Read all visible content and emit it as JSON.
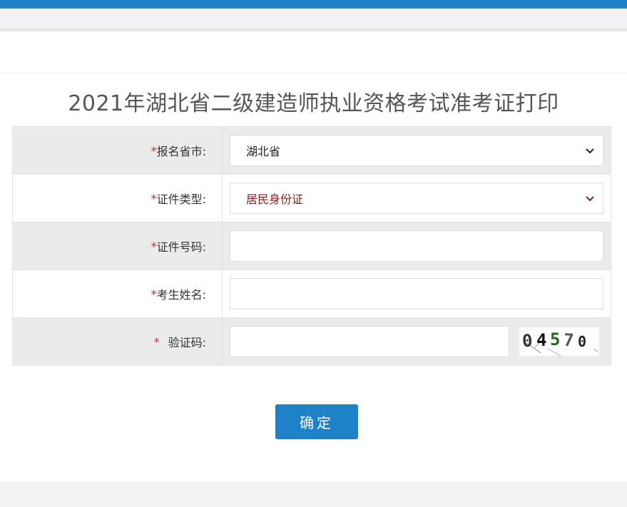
{
  "page": {
    "title": "2021年湖北省二级建造师执业资格考试准考证打印"
  },
  "form": {
    "province": {
      "required_mark": "*",
      "label": "报名省市:",
      "value": "湖北省"
    },
    "id_type": {
      "required_mark": "*",
      "label": "证件类型:",
      "value": "居民身份证"
    },
    "id_number": {
      "required_mark": "*",
      "label": "证件号码:",
      "value": ""
    },
    "name": {
      "required_mark": "*",
      "label": "考生姓名:",
      "value": ""
    },
    "captcha": {
      "required_mark": "*",
      "label": "验证码:",
      "value": "",
      "image_text": "04570"
    }
  },
  "submit": {
    "label": "确定"
  },
  "colors": {
    "primary": "#1e82c8",
    "required": "#e0242b",
    "row_gray": "#ebebeb"
  }
}
